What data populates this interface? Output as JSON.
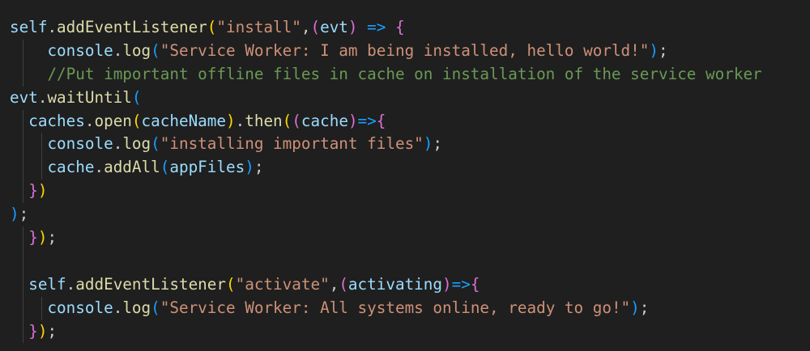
{
  "editor": {
    "lines": [
      {
        "guides": [],
        "tokens": [
          {
            "t": "self",
            "c": "ident"
          },
          {
            "t": ".",
            "c": "punc"
          },
          {
            "t": "addEventListener",
            "c": "func"
          },
          {
            "t": "(",
            "c": "b1"
          },
          {
            "t": "\"install\"",
            "c": "str"
          },
          {
            "t": ",",
            "c": "punc"
          },
          {
            "t": "(",
            "c": "b2"
          },
          {
            "t": "evt",
            "c": "ident"
          },
          {
            "t": ")",
            "c": "b2"
          },
          {
            "t": " ",
            "c": "punc"
          },
          {
            "t": "=>",
            "c": "b3"
          },
          {
            "t": " ",
            "c": "punc"
          },
          {
            "t": "{",
            "c": "b2"
          }
        ]
      },
      {
        "guides": [
          1
        ],
        "tokens": [
          {
            "t": "    ",
            "c": "punc"
          },
          {
            "t": "console",
            "c": "ident"
          },
          {
            "t": ".",
            "c": "punc"
          },
          {
            "t": "log",
            "c": "func"
          },
          {
            "t": "(",
            "c": "b3"
          },
          {
            "t": "\"Service Worker: I am being installed, hello world!\"",
            "c": "str"
          },
          {
            "t": ")",
            "c": "b3"
          },
          {
            "t": ";",
            "c": "punc"
          }
        ]
      },
      {
        "guides": [
          1
        ],
        "tokens": [
          {
            "t": "    ",
            "c": "punc"
          },
          {
            "t": "//Put important offline files in cache on installation of the service worker",
            "c": "comment"
          }
        ]
      },
      {
        "guides": [],
        "tokens": [
          {
            "t": "evt",
            "c": "ident"
          },
          {
            "t": ".",
            "c": "punc"
          },
          {
            "t": "waitUntil",
            "c": "func"
          },
          {
            "t": "(",
            "c": "b3"
          }
        ]
      },
      {
        "guides": [
          1
        ],
        "tokens": [
          {
            "t": "  ",
            "c": "punc"
          },
          {
            "t": "caches",
            "c": "ident"
          },
          {
            "t": ".",
            "c": "punc"
          },
          {
            "t": "open",
            "c": "func"
          },
          {
            "t": "(",
            "c": "b1"
          },
          {
            "t": "cacheName",
            "c": "ident"
          },
          {
            "t": ")",
            "c": "b1"
          },
          {
            "t": ".",
            "c": "punc"
          },
          {
            "t": "then",
            "c": "func"
          },
          {
            "t": "(",
            "c": "b1"
          },
          {
            "t": "(",
            "c": "b2"
          },
          {
            "t": "cache",
            "c": "ident"
          },
          {
            "t": ")",
            "c": "b2"
          },
          {
            "t": "=>",
            "c": "b3"
          },
          {
            "t": "{",
            "c": "b2"
          }
        ]
      },
      {
        "guides": [
          1,
          3
        ],
        "tokens": [
          {
            "t": "    ",
            "c": "punc"
          },
          {
            "t": "console",
            "c": "ident"
          },
          {
            "t": ".",
            "c": "punc"
          },
          {
            "t": "log",
            "c": "func"
          },
          {
            "t": "(",
            "c": "b3"
          },
          {
            "t": "\"installing important files\"",
            "c": "str"
          },
          {
            "t": ")",
            "c": "b3"
          },
          {
            "t": ";",
            "c": "punc"
          }
        ]
      },
      {
        "guides": [
          1,
          3
        ],
        "tokens": [
          {
            "t": "    ",
            "c": "punc"
          },
          {
            "t": "cache",
            "c": "ident"
          },
          {
            "t": ".",
            "c": "punc"
          },
          {
            "t": "addAll",
            "c": "func"
          },
          {
            "t": "(",
            "c": "b3"
          },
          {
            "t": "appFiles",
            "c": "ident"
          },
          {
            "t": ")",
            "c": "b3"
          },
          {
            "t": ";",
            "c": "punc"
          }
        ]
      },
      {
        "guides": [
          1
        ],
        "tokens": [
          {
            "t": "  ",
            "c": "punc"
          },
          {
            "t": "}",
            "c": "b2"
          },
          {
            "t": ")",
            "c": "b1"
          }
        ]
      },
      {
        "guides": [],
        "tokens": [
          {
            "t": ")",
            "c": "b3"
          },
          {
            "t": ";",
            "c": "punc"
          }
        ]
      },
      {
        "guides": [
          1
        ],
        "tokens": [
          {
            "t": "  ",
            "c": "punc"
          },
          {
            "t": "}",
            "c": "b2"
          },
          {
            "t": ")",
            "c": "b1"
          },
          {
            "t": ";",
            "c": "punc"
          }
        ]
      },
      {
        "guides": [
          1
        ],
        "tokens": []
      },
      {
        "guides": [
          1
        ],
        "tokens": [
          {
            "t": "  ",
            "c": "punc"
          },
          {
            "t": "self",
            "c": "ident"
          },
          {
            "t": ".",
            "c": "punc"
          },
          {
            "t": "addEventListener",
            "c": "func"
          },
          {
            "t": "(",
            "c": "b1"
          },
          {
            "t": "\"activate\"",
            "c": "str"
          },
          {
            "t": ",",
            "c": "punc"
          },
          {
            "t": "(",
            "c": "b2"
          },
          {
            "t": "activating",
            "c": "ident"
          },
          {
            "t": ")",
            "c": "b2"
          },
          {
            "t": "=>",
            "c": "b3"
          },
          {
            "t": "{",
            "c": "b2"
          }
        ]
      },
      {
        "guides": [
          1,
          3
        ],
        "tokens": [
          {
            "t": "    ",
            "c": "punc"
          },
          {
            "t": "console",
            "c": "ident"
          },
          {
            "t": ".",
            "c": "punc"
          },
          {
            "t": "log",
            "c": "func"
          },
          {
            "t": "(",
            "c": "b3"
          },
          {
            "t": "\"Service Worker: All systems online, ready to go!\"",
            "c": "str"
          },
          {
            "t": ")",
            "c": "b3"
          },
          {
            "t": ";",
            "c": "punc"
          }
        ]
      },
      {
        "guides": [
          1
        ],
        "tokens": [
          {
            "t": "  ",
            "c": "punc"
          },
          {
            "t": "}",
            "c": "b2"
          },
          {
            "t": ")",
            "c": "b1"
          },
          {
            "t": ";",
            "c": "punc"
          }
        ]
      }
    ]
  }
}
